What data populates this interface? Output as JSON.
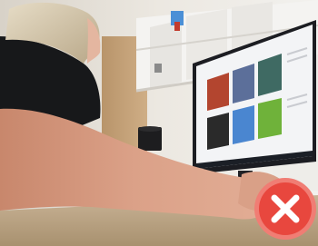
{
  "photo": {
    "subject": "person-at-computer",
    "overlay_icon": "close-icon",
    "overlay_color": "#e8473e",
    "overlay_ring_color": "#f07d74"
  },
  "monitor": {
    "screen_tiles": [
      {
        "color": "#b3452f"
      },
      {
        "color": "#5c6f9a"
      },
      {
        "color": "#3f6a63"
      },
      {
        "color": "#2a2a2a"
      },
      {
        "color": "#4a86d0"
      },
      {
        "color": "#6fb23a"
      }
    ],
    "taskbar_color": "#1b1f26"
  }
}
